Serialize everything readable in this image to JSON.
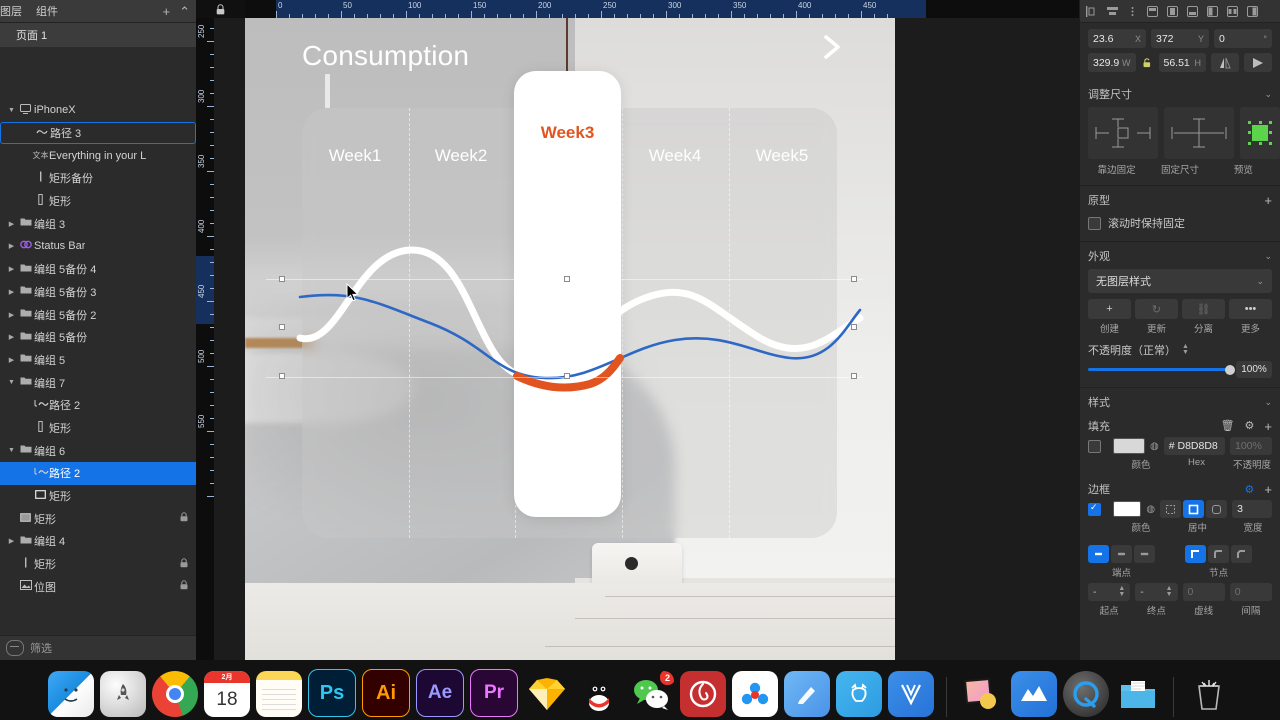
{
  "app": {
    "left_panel": {
      "tabs": [
        "图层",
        "组件"
      ],
      "add_icon": "+",
      "collapse_icon": "⌃",
      "page": "页面 1",
      "filter_placeholder": "筛选",
      "layers": [
        {
          "indent": 0,
          "arrow": "▼",
          "icon": "monitor",
          "label": "iPhoneX",
          "locked": false,
          "state": "none"
        },
        {
          "indent": 1,
          "arrow": "",
          "icon": "path",
          "label": "路径 3",
          "locked": false,
          "state": "outline"
        },
        {
          "indent": 1,
          "arrow": "",
          "icon": "text",
          "label": "Everything in your L",
          "locked": false,
          "state": "none"
        },
        {
          "indent": 1,
          "arrow": "",
          "icon": "rect-thin",
          "label": "矩形备份",
          "locked": false,
          "state": "none"
        },
        {
          "indent": 1,
          "arrow": "",
          "icon": "rect-thin2",
          "label": "矩形",
          "locked": false,
          "state": "none"
        },
        {
          "indent": 0,
          "arrow": "▶",
          "icon": "folder",
          "label": "编组 3",
          "locked": false,
          "state": "none"
        },
        {
          "indent": 0,
          "arrow": "▶",
          "icon": "symbol",
          "label": "Status Bar",
          "locked": false,
          "state": "none"
        },
        {
          "indent": 0,
          "arrow": "▶",
          "icon": "folder",
          "label": "编组 5备份 4",
          "locked": false,
          "state": "none"
        },
        {
          "indent": 0,
          "arrow": "▶",
          "icon": "folder",
          "label": "编组 5备份 3",
          "locked": false,
          "state": "none"
        },
        {
          "indent": 0,
          "arrow": "▶",
          "icon": "folder",
          "label": "编组 5备份 2",
          "locked": false,
          "state": "none"
        },
        {
          "indent": 0,
          "arrow": "▶",
          "icon": "folder",
          "label": "编组 5备份",
          "locked": false,
          "state": "none"
        },
        {
          "indent": 0,
          "arrow": "▶",
          "icon": "folder",
          "label": "编组 5",
          "locked": false,
          "state": "none"
        },
        {
          "indent": 0,
          "arrow": "▼",
          "icon": "folder",
          "label": "编组 7",
          "locked": false,
          "state": "none"
        },
        {
          "indent": 1,
          "arrow": "",
          "icon": "path-mask",
          "label": "路径 2",
          "locked": false,
          "state": "none"
        },
        {
          "indent": 1,
          "arrow": "",
          "icon": "rect-thin2",
          "label": "矩形",
          "locked": false,
          "state": "none"
        },
        {
          "indent": 0,
          "arrow": "▼",
          "icon": "folder",
          "label": "编组 6",
          "locked": false,
          "state": "none"
        },
        {
          "indent": 1,
          "arrow": "",
          "icon": "path-mask",
          "label": "路径 2",
          "locked": false,
          "state": "fill"
        },
        {
          "indent": 1,
          "arrow": "",
          "icon": "rect-outline",
          "label": "矩形",
          "locked": false,
          "state": "none"
        },
        {
          "indent": 0,
          "arrow": "",
          "icon": "rect-filled",
          "label": "矩形",
          "locked": true,
          "state": "none"
        },
        {
          "indent": 0,
          "arrow": "▶",
          "icon": "folder",
          "label": "编组 4",
          "locked": false,
          "state": "none"
        },
        {
          "indent": 0,
          "arrow": "",
          "icon": "rect-thin",
          "label": "矩形",
          "locked": true,
          "state": "none"
        },
        {
          "indent": 0,
          "arrow": "",
          "icon": "bitmap",
          "label": "位图",
          "locked": true,
          "state": "none"
        }
      ]
    },
    "canvas": {
      "ruler_h_labels": [
        "0",
        "50",
        "100",
        "150",
        "200",
        "250",
        "300",
        "350",
        "400",
        "450"
      ],
      "ruler_v_labels": [
        "250",
        "300",
        "350",
        "400",
        "450",
        "500",
        "550"
      ],
      "artboard": {
        "title": "Consumption",
        "next_caret": "next-arrow",
        "weeks": [
          "Week1",
          "Week2",
          "Week3",
          "Week4",
          "Week5"
        ],
        "highlighted_week": "Week3",
        "highlight_color": "#e2541f"
      }
    },
    "right_panel": {
      "align_tools": [
        "align-left",
        "align-center-h",
        "more-align",
        "align-top",
        "align-middle",
        "align-bottom",
        "dist-h",
        "dist-v",
        "dist-more"
      ],
      "transform": {
        "x": "23.6",
        "x_label": "X",
        "y": "372",
        "y_label": "Y",
        "rotation": "0",
        "rotation_label": "°",
        "w": "329.91",
        "w_label": "W",
        "h": "56.51",
        "h_label": "H",
        "lock_icon": "lock-open-icon",
        "flip_v": "flip-vertical-icon",
        "flip_h": "flip-horizontal-icon"
      },
      "resize": {
        "title": "调整尺寸",
        "options": [
          "靠边固定",
          "固定尺寸",
          "预览"
        ]
      },
      "prototype": {
        "title": "原型",
        "checkbox_label": "滚动时保持固定",
        "checked": false
      },
      "appearance": {
        "title": "外观",
        "layer_style": "无图层样式",
        "buttons": [
          "创建",
          "更新",
          "分离",
          "更多"
        ],
        "opacity_label": "不透明度（正常）",
        "opacity_value": "100%"
      },
      "style": {
        "title": "样式",
        "fill": {
          "title": "填充",
          "hex": "# D8D8D8",
          "color": "#D8D8D8",
          "opacity": "100%",
          "caption_color": "颜色",
          "caption_hex": "Hex",
          "caption_opacity": "不透明度",
          "enabled": false
        },
        "border": {
          "title": "边框",
          "enabled": true,
          "color": "#FFFFFF",
          "caption_color": "颜色",
          "position": "居中",
          "width": "3",
          "caption_width": "宽度",
          "endpoint_label": "端点",
          "node_label": "节点",
          "start_value": "-",
          "end_value": "-",
          "dash_value": "0",
          "gap_value": "0",
          "caption_start": "起点",
          "caption_end": "终点",
          "caption_dash": "虚线",
          "caption_gap": "间隔"
        }
      }
    },
    "dock": {
      "items": [
        {
          "name": "finder",
          "label": "",
          "running": true
        },
        {
          "name": "launchpad",
          "label": "",
          "running": false
        },
        {
          "name": "chrome",
          "label": "",
          "running": true
        },
        {
          "name": "calendar",
          "label": "18",
          "running": true
        },
        {
          "name": "notes",
          "label": "",
          "running": false
        },
        {
          "name": "photoshop",
          "label": "Ps",
          "running": false
        },
        {
          "name": "illustrator",
          "label": "Ai",
          "running": false
        },
        {
          "name": "after-effects",
          "label": "Ae",
          "running": false
        },
        {
          "name": "premiere",
          "label": "Pr",
          "running": false
        },
        {
          "name": "sketch",
          "label": "",
          "running": false
        },
        {
          "name": "qq",
          "label": "",
          "running": false
        },
        {
          "name": "wechat",
          "label": "",
          "running": true,
          "badge": "2"
        },
        {
          "name": "netease-music",
          "label": "",
          "running": true
        },
        {
          "name": "baidu-netdisk",
          "label": "",
          "running": true
        },
        {
          "name": "bear",
          "label": "",
          "running": true
        },
        {
          "name": "youdao",
          "label": "",
          "running": true
        },
        {
          "name": "wps",
          "label": "",
          "running": true
        },
        {
          "name": "preview",
          "label": "",
          "running": false
        },
        {
          "name": "xmind",
          "label": "",
          "running": false
        },
        {
          "name": "quicktime",
          "label": "",
          "running": true
        },
        {
          "name": "downloads-folder",
          "label": "",
          "running": false
        },
        {
          "name": "trash",
          "label": "",
          "running": false
        }
      ]
    }
  },
  "chart_data": {
    "type": "line",
    "title": "Consumption",
    "categories": [
      "Week1",
      "Week2",
      "Week3",
      "Week4",
      "Week5"
    ],
    "series": [
      {
        "name": "white-curve",
        "color": "#ffffff",
        "values": [
          18,
          72,
          30,
          8,
          70,
          22,
          40
        ]
      },
      {
        "name": "blue-curve",
        "color": "#2e68c4",
        "values": [
          72,
          66,
          44,
          22,
          46,
          52,
          38,
          74
        ]
      },
      {
        "name": "orange-highlight",
        "color": "#e2541f",
        "values": [
          20,
          8,
          28
        ],
        "segment": "Week3"
      }
    ],
    "xlabel": "",
    "ylabel": "",
    "grid": false,
    "legend": "none"
  }
}
